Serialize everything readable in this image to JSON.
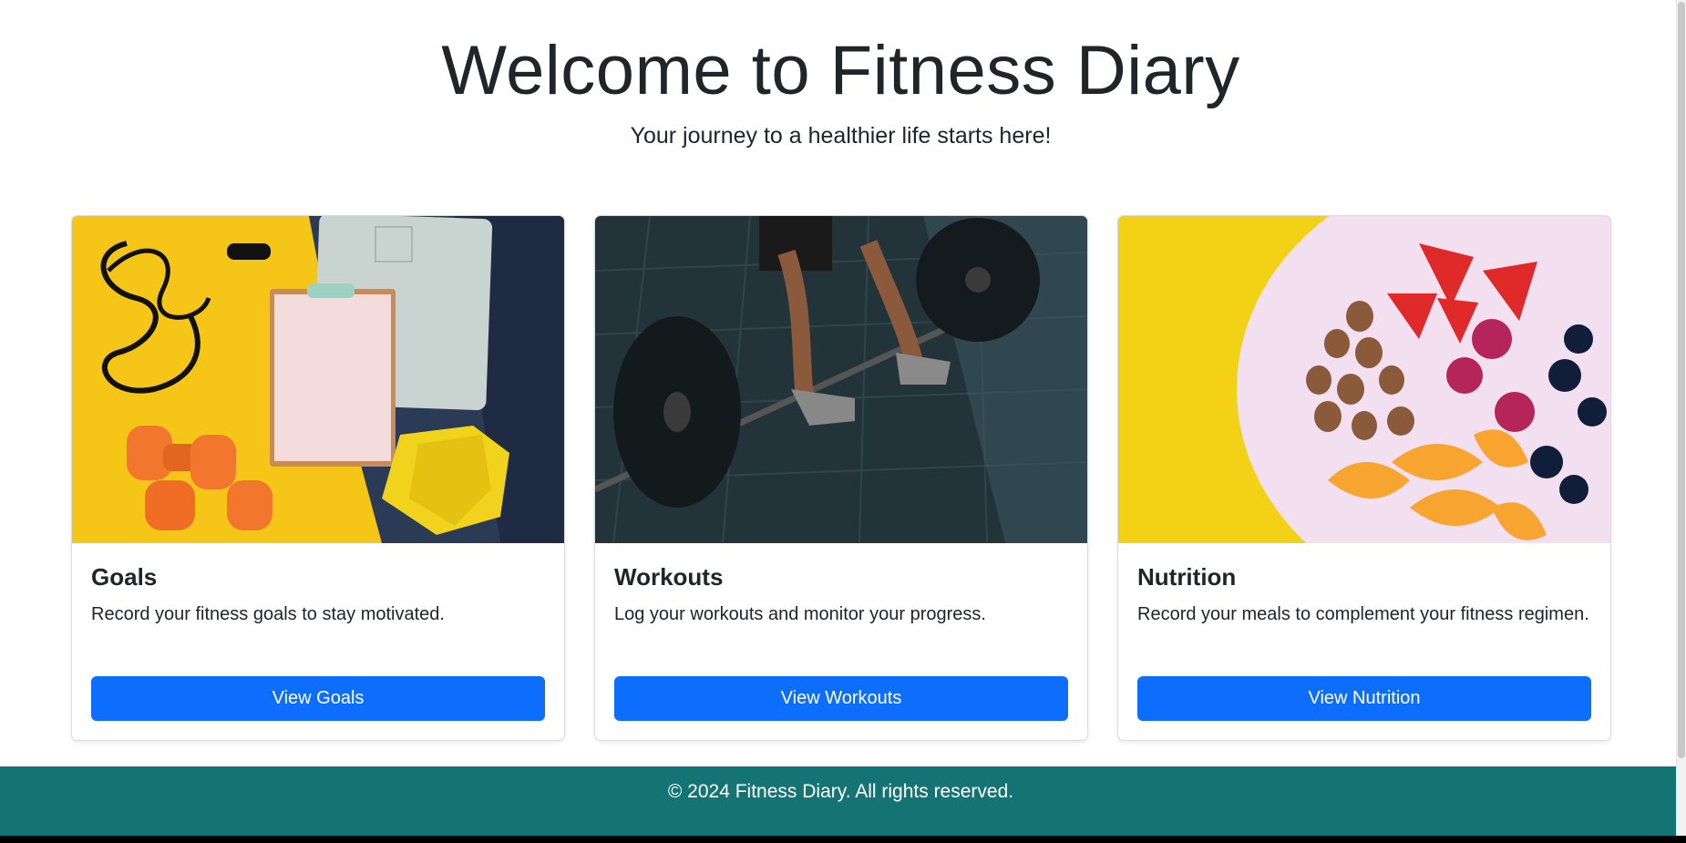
{
  "hero": {
    "title": "Welcome to Fitness Diary",
    "subtitle": "Your journey to a healthier life starts here!"
  },
  "cards": [
    {
      "title": "Goals",
      "text": "Record your fitness goals to stay motivated.",
      "button": "View Goals"
    },
    {
      "title": "Workouts",
      "text": "Log your workouts and monitor your progress.",
      "button": "View Workouts"
    },
    {
      "title": "Nutrition",
      "text": "Record your meals to complement your fitness regimen.",
      "button": "View Nutrition"
    }
  ],
  "footer": {
    "text": "© 2024 Fitness Diary. All rights reserved."
  },
  "colors": {
    "primary_button": "#0d6efd",
    "footer_bg": "#147373",
    "heading_text": "#212529"
  }
}
